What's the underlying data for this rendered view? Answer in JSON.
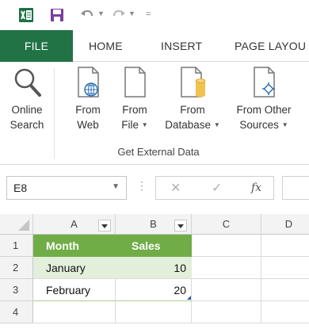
{
  "quick_access": {
    "customize_glyph": "=",
    "icons": [
      "excel-logo-icon",
      "save-icon",
      "undo-icon",
      "redo-icon"
    ]
  },
  "tabs": {
    "file": "FILE",
    "home": "HOME",
    "insert": "INSERT",
    "page_layout": "PAGE LAYOU"
  },
  "ribbon": {
    "group_label": "Get External Data",
    "buttons": [
      {
        "line1": "Online",
        "line2": "Search",
        "icon": "magnifier-icon",
        "dropdown": false
      },
      {
        "line1": "From",
        "line2": "Web",
        "icon": "web-page-icon",
        "dropdown": false
      },
      {
        "line1": "From",
        "line2": "File",
        "icon": "file-icon",
        "dropdown": true
      },
      {
        "line1": "From",
        "line2": "Database",
        "icon": "database-icon",
        "dropdown": true
      },
      {
        "line1": "From Other",
        "line2": "Sources",
        "icon": "other-sources-icon",
        "dropdown": true
      }
    ]
  },
  "formula_bar": {
    "name_box": "E8",
    "cancel": "✕",
    "enter": "✓",
    "fx": "fx",
    "value": ""
  },
  "grid": {
    "columns": [
      "A",
      "B",
      "C",
      "D"
    ],
    "rows": [
      "1",
      "2",
      "3",
      "4"
    ],
    "table": {
      "headers": [
        "Month",
        "Sales"
      ],
      "rows": [
        {
          "month": "January",
          "sales": "10"
        },
        {
          "month": "February",
          "sales": "20"
        }
      ]
    }
  },
  "colors": {
    "file_tab": "#217346",
    "table_header": "#70ad47",
    "table_band": "#e2efda",
    "excel_green": "#1e7145",
    "save_purple": "#7a3e9d"
  }
}
